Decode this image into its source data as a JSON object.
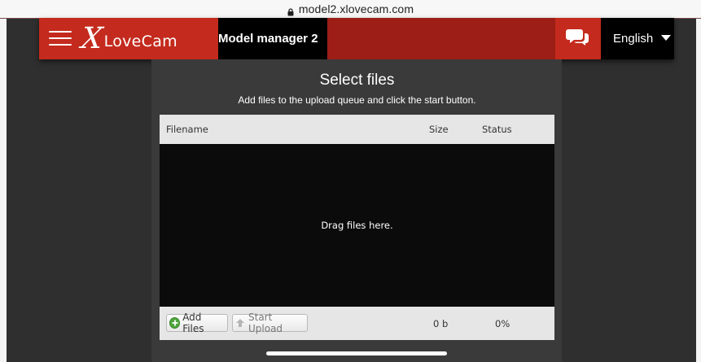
{
  "browser": {
    "url": "model2.xlovecam.com",
    "lock_icon": "lock-icon"
  },
  "header": {
    "menu_icon": "hamburger-icon",
    "logo_x": "X",
    "logo_rest": "LoveCam",
    "title": "Model manager 2",
    "chat_icon": "chat-bubbles-icon",
    "language": "English",
    "language_arrow_icon": "caret-down-icon",
    "colors": {
      "brand_red": "#c42a1d",
      "dark_red": "#9c1e16",
      "black": "#000000"
    }
  },
  "uploader": {
    "title": "Select files",
    "subtitle": "Add files to the upload queue and click the start button.",
    "columns": {
      "filename": "Filename",
      "size": "Size",
      "status": "Status"
    },
    "dropzone_text": "Drag files here.",
    "add_files_label": "Add Files",
    "start_upload_label": "Start Upload",
    "total_size": "0 b",
    "total_status": "0%"
  }
}
